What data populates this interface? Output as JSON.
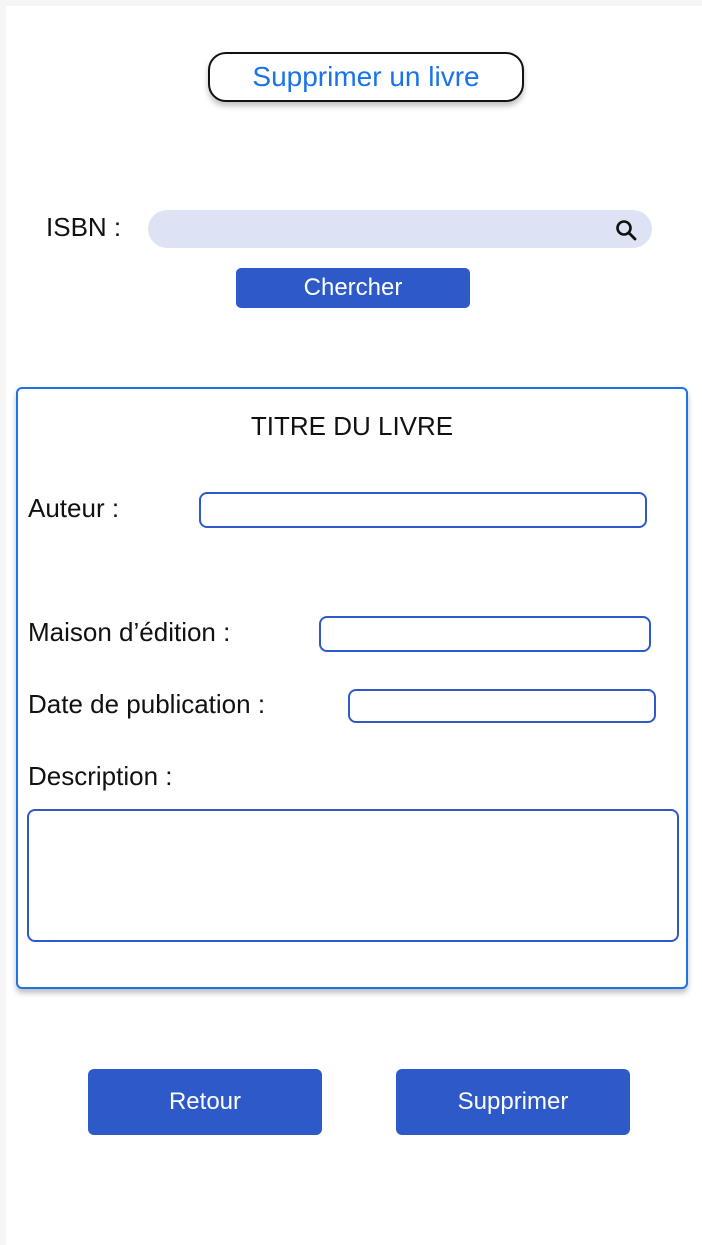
{
  "header": {
    "title": "Supprimer un livre"
  },
  "search": {
    "label": "ISBN :",
    "value": "",
    "placeholder": "",
    "icon": "search-icon",
    "button_label": "Chercher"
  },
  "book": {
    "title": "TITRE DU LIVRE",
    "fields": {
      "author_label": "Auteur :",
      "author_value": "",
      "publisher_label": "Maison d’édition :",
      "publisher_value": "",
      "date_label": "Date de publication :",
      "date_value": "",
      "description_label": "Description :",
      "description_value": ""
    }
  },
  "actions": {
    "back_label": "Retour",
    "delete_label": "Supprimer"
  },
  "colors": {
    "accent": "#2d5ac8",
    "link": "#1a73e8",
    "search_bg": "#dde3f4"
  }
}
